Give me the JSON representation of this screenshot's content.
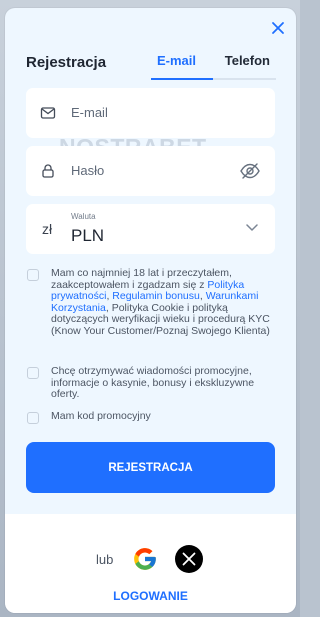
{
  "modal": {
    "title": "Rejestracja",
    "close_icon": "close-icon"
  },
  "tabs": {
    "email": "E-mail",
    "phone": "Telefon",
    "active": "email"
  },
  "form": {
    "email_placeholder": "E-mail",
    "password_placeholder": "Hasło",
    "watermark": "NOSTRABET",
    "currency_label": "Waluta",
    "currency_value": "PLN",
    "currency_symbol": "zł"
  },
  "checkboxes": {
    "terms_prefix": "Mam co najmniej 18 lat i przeczytałem, zaakceptowałem i zgadzam się z ",
    "privacy_policy": "Polityka prywatności",
    "sep1": ", ",
    "bonus_rules": "Regulamin bonusu",
    "sep2": ", ",
    "user_terms": "Warunkami Korzystania",
    "terms_suffix": ", Polityka Cookie i polityką dotyczących weryfikacji wieku i procedurą KYC (Know Your Customer/Poznaj Swojego Klienta)",
    "marketing": "Chcę otrzymywać wiadomości promocyjne, informacje o kasynie, bonusy i ekskluzywne oferty.",
    "promo": "Mam kod promocyjny"
  },
  "actions": {
    "submit": "REJESTRACJA",
    "or": "lub",
    "login": "LOGOWANIE"
  },
  "colors": {
    "accent": "#1f6fff",
    "modal_bg": "#eef7ff",
    "field_bg": "#ffffff"
  },
  "icons": {
    "email": "mail-icon",
    "password": "lock-icon",
    "visibility": "eye-off-icon",
    "dropdown": "chevron-down-icon",
    "google": "google-icon",
    "x": "x-icon"
  }
}
